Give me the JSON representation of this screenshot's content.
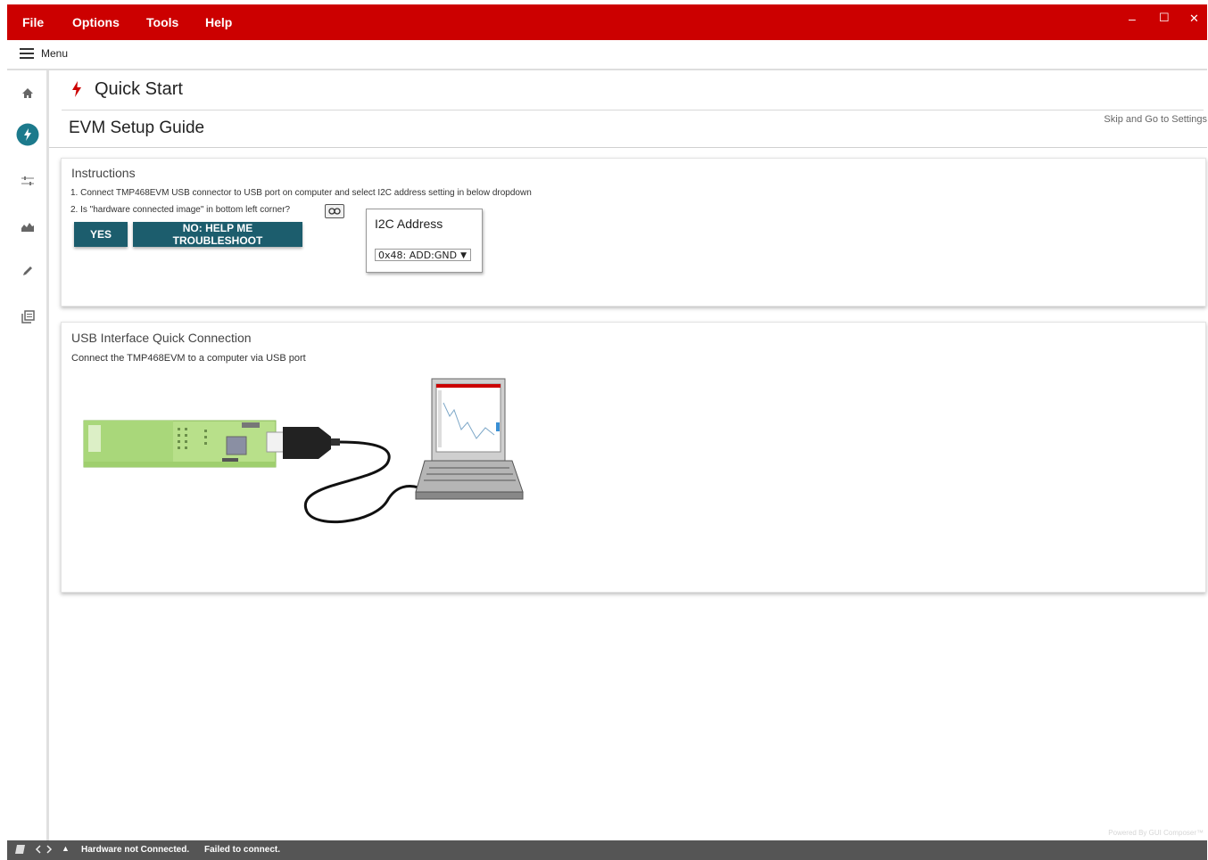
{
  "menubar": {
    "items": [
      "File",
      "Options",
      "Tools",
      "Help"
    ],
    "window_controls": {
      "minimize": "–",
      "maximize": "☐",
      "close": "✕"
    }
  },
  "menu_row": {
    "label": "Menu"
  },
  "sidebar": {
    "icons": [
      "home-icon",
      "quick-start-bolt-icon",
      "settings-sliders-icon",
      "chart-icon",
      "pencil-icon",
      "register-map-icon"
    ],
    "active": "quick-start-bolt-icon"
  },
  "page": {
    "title": "Quick Start",
    "subtitle": "EVM Setup Guide",
    "skip_link": "Skip and Go to Settings"
  },
  "instructions": {
    "title": "Instructions",
    "step1": "1. Connect TMP468EVM USB connector to USB port on computer and select I2C address setting in below dropdown",
    "step2": "2. Is \"hardware connected image\" in bottom left corner?",
    "yes_button": "YES",
    "no_button": "NO: HELP ME TROUBLESHOOT",
    "i2c": {
      "title": "I2C Address",
      "selected": "0x48: ADD:GND"
    }
  },
  "usb_card": {
    "title": "USB Interface Quick Connection",
    "text": "Connect the TMP468EVM to a computer via USB port"
  },
  "statusbar": {
    "arrow": "▲",
    "hardware_status": "Hardware not Connected.",
    "connect_status": "Failed to connect."
  },
  "footer": {
    "powered_by": "Powered By GUI Composer™"
  },
  "colors": {
    "brand_red": "#cc0000",
    "button_teal": "#1c5d6d",
    "active_icon": "#1c7a8c",
    "status_bar": "#555555"
  }
}
